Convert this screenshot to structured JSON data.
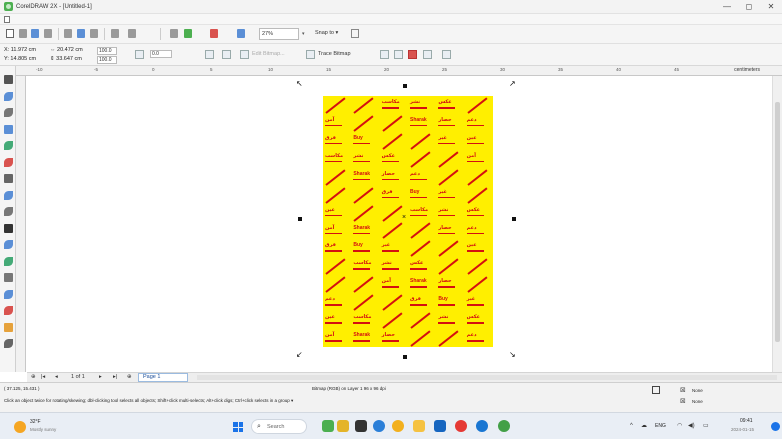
{
  "window": {
    "title": "CorelDRAW 2X - [Untitled-1]",
    "controls": {
      "minimize": "—",
      "maximize": "◻",
      "close": "✕"
    }
  },
  "toolbar": {
    "zoom_value": "27%",
    "snap_to_label": "Snap to ▾",
    "icons": [
      "new-icon",
      "open-icon",
      "save-icon",
      "print-icon",
      "cut-icon",
      "copy-icon",
      "paste-icon",
      "undo-icon",
      "redo-icon",
      "search-icon",
      "import-icon",
      "export-icon",
      "app-launcher-icon",
      "zoom-dropdown"
    ]
  },
  "property_bar": {
    "x": "X: 11.972 cm",
    "y": "Y: 14.805 cm",
    "width": "⇔ 20.472 cm",
    "height": "⇕ 33.647 cm",
    "scale_x": "100.0",
    "scale_y": "100.0",
    "rotation": "0.0",
    "edit_bitmap": "Edit Bitmap...",
    "trace_bitmap": "Trace Bitmap"
  },
  "ruler": {
    "units": "centimeters",
    "tick_labels": [
      "-10",
      "-5",
      "0",
      "5",
      "10",
      "15",
      "20",
      "25",
      "30",
      "35",
      "40",
      "45"
    ]
  },
  "toolbox": {
    "tools": [
      "pick-tool-icon",
      "shape-tool-icon",
      "crop-tool-icon",
      "zoom-tool-icon",
      "freehand-tool-icon",
      "artistic-media-icon",
      "rectangle-tool-icon",
      "ellipse-tool-icon",
      "polygon-tool-icon",
      "text-tool-icon",
      "parallel-dimension-icon",
      "connector-tool-icon",
      "drop-shadow-icon",
      "transparency-icon",
      "eyedropper-icon",
      "interactive-fill-icon",
      "smart-fill-icon"
    ]
  },
  "document": {
    "bitmap_words": [
      "مكاسب",
      "نشر",
      "عكس",
      "آمن",
      "Sharak",
      "حصار",
      "دعم",
      "فرق",
      "Buy",
      "غير",
      "عين"
    ],
    "background_color": "#ffef00",
    "ink_color": "#d41010"
  },
  "page_nav": {
    "first": "|◂",
    "prev": "◂",
    "page_count": "1 of 1",
    "next": "▸",
    "last": "▸|",
    "add_page": "⊕",
    "page_tab": "Page 1"
  },
  "status": {
    "cursor_position": "( 37.125, 15.431 )",
    "object_info": "Bitmap (RGB) on Layer 1 96 x 96 dpi",
    "hint": "Click an object twice for rotating/skewing; dbl-clicking tool selects all objects; Shift+click multi-selects; Alt+click digs; Ctrl+click selects in a group ▾",
    "fill": "None",
    "outline": "None"
  },
  "taskbar": {
    "weather_temp": "32°F",
    "weather_desc": "Mostly sunny",
    "search_placeholder": "Search",
    "time": "09:41",
    "date": "2024-01-15",
    "lang": "ENG"
  }
}
